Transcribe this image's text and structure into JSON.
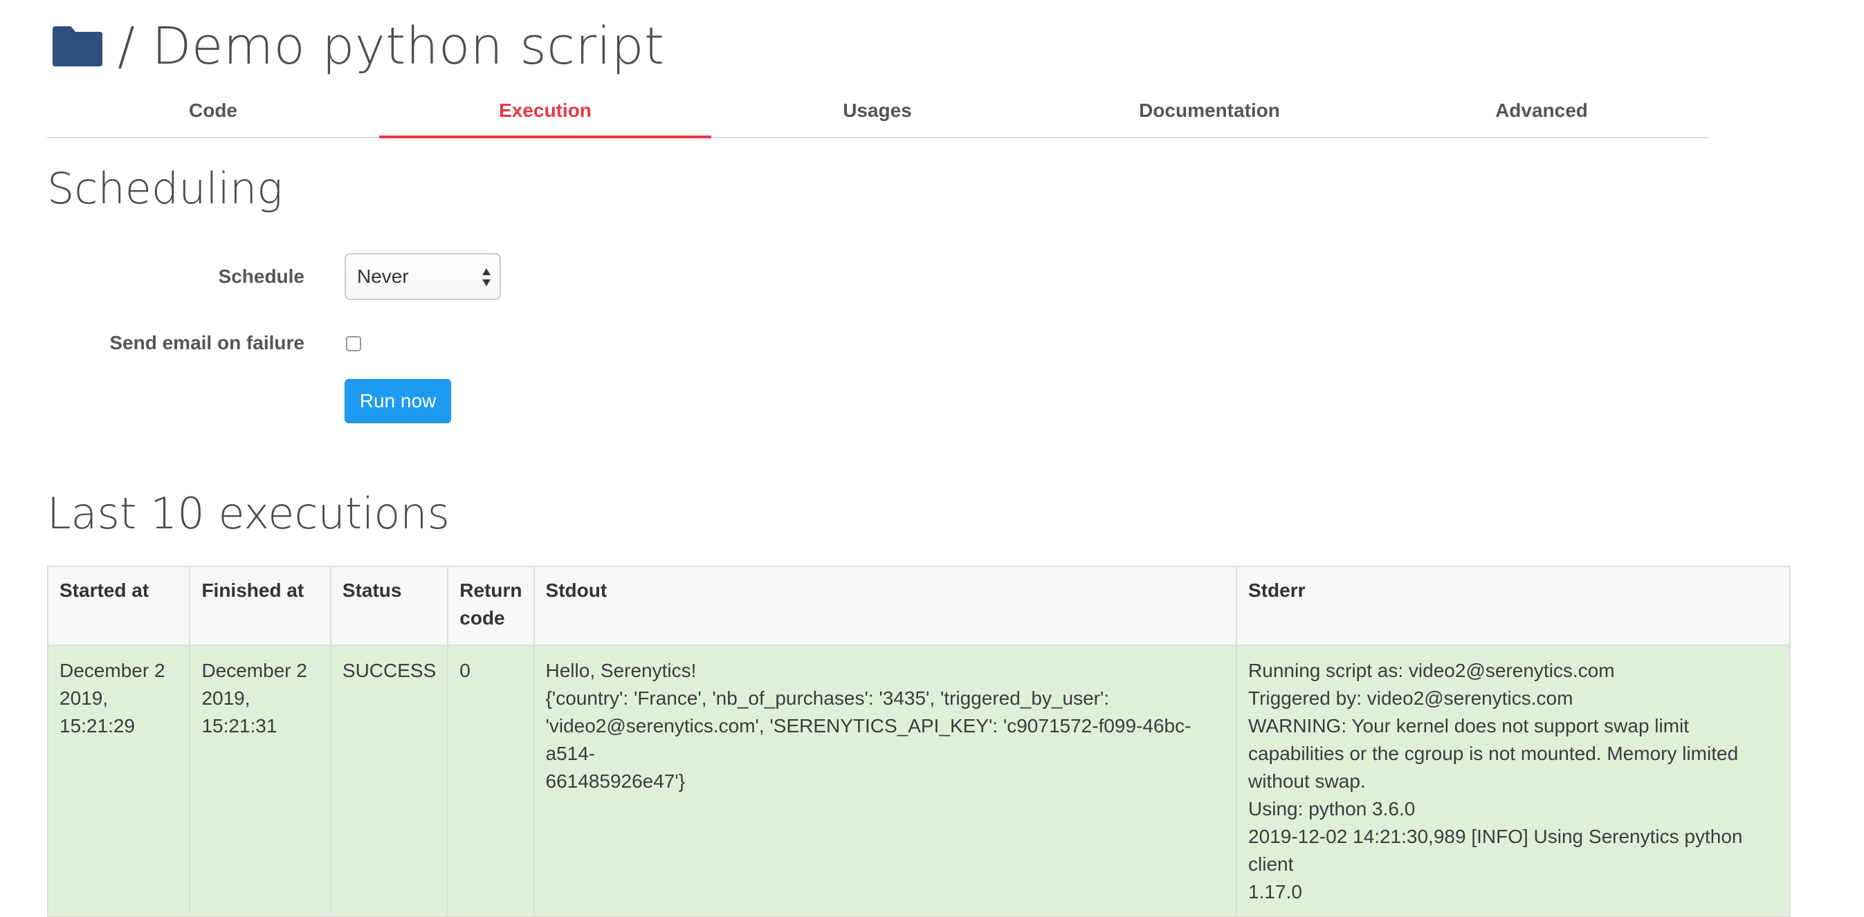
{
  "header": {
    "title": "/ Demo python script"
  },
  "tabs": [
    {
      "label": "Code"
    },
    {
      "label": "Execution"
    },
    {
      "label": "Usages"
    },
    {
      "label": "Documentation"
    },
    {
      "label": "Advanced"
    }
  ],
  "active_tab": "Execution",
  "scheduling": {
    "title": "Scheduling",
    "schedule_label": "Schedule",
    "schedule_value": "Never",
    "email_label": "Send email on failure",
    "email_checked": false,
    "run_button": "Run now"
  },
  "executions": {
    "title": "Last 10 executions",
    "columns": [
      "Started at",
      "Finished at",
      "Status",
      "Return\ncode",
      "Stdout",
      "Stderr"
    ],
    "rows": [
      {
        "started_at": "December 2\n2019,\n15:21:29",
        "finished_at": "December 2\n2019,\n15:21:31",
        "status": "SUCCESS",
        "return_code": "0",
        "stdout": "Hello, Serenytics!\n{'country': 'France', 'nb_of_purchases': '3435', 'triggered_by_user':\n'video2@serenytics.com', 'SERENYTICS_API_KEY': 'c9071572-f099-46bc-a514-\n661485926e47'}",
        "stderr": "Running script as: video2@serenytics.com\nTriggered by: video2@serenytics.com\nWARNING: Your kernel does not support swap limit\ncapabilities or the cgroup is not mounted. Memory limited\nwithout swap.\nUsing: python 3.6.0\n2019-12-02 14:21:30,989 [INFO] Using Serenytics python client\n1.17.0"
      }
    ]
  },
  "colors": {
    "accent": "#e53946",
    "primary_button": "#1e9bf0",
    "folder_icon": "#2f4f7f",
    "success_row": "#dff0d8"
  },
  "icons": {
    "folder": "folder-icon",
    "select_arrows": "select-arrows-icon"
  }
}
